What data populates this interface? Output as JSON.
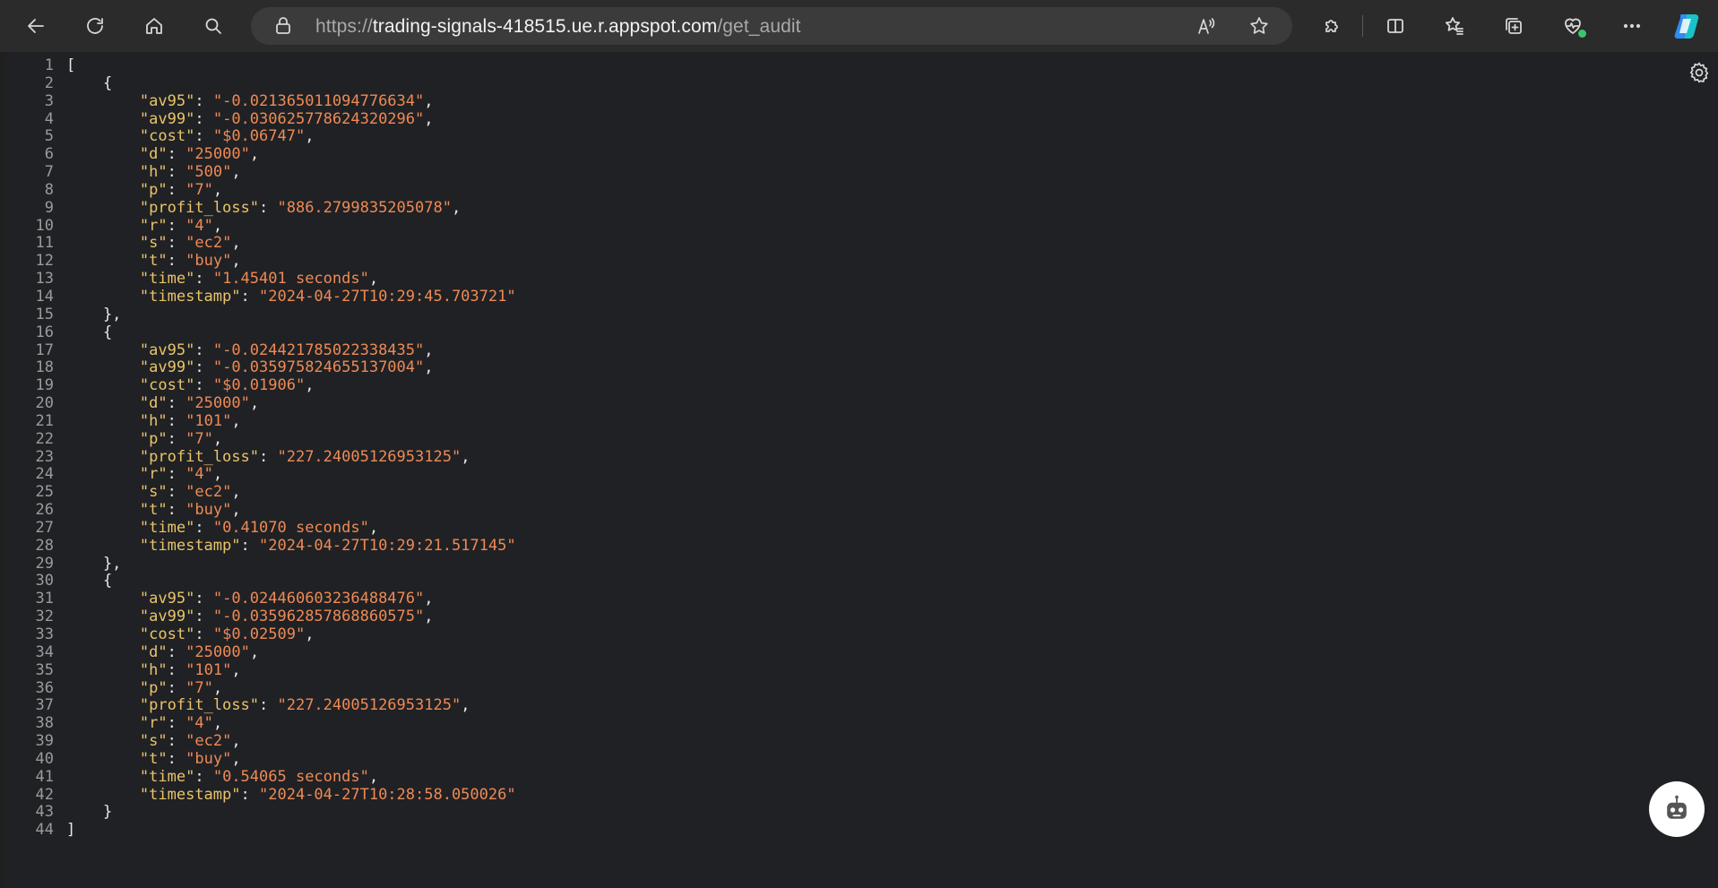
{
  "browser": {
    "url_scheme": "https://",
    "url_host": "trading-signals-418515.ue.r.appspot.com",
    "url_path": "/get_audit"
  },
  "json_view": {
    "lines": [
      {
        "n": "1",
        "t": "[",
        "kind": "punct"
      },
      {
        "n": "2",
        "t": "    {",
        "kind": "punct"
      },
      {
        "n": "3",
        "k": "av95",
        "v": "-0.021365011094776634",
        "indent": "        ",
        "tail": ","
      },
      {
        "n": "4",
        "k": "av99",
        "v": "-0.030625778624320296",
        "indent": "        ",
        "tail": ","
      },
      {
        "n": "5",
        "k": "cost",
        "v": "$0.06747",
        "indent": "        ",
        "tail": ","
      },
      {
        "n": "6",
        "k": "d",
        "v": "25000",
        "indent": "        ",
        "tail": ","
      },
      {
        "n": "7",
        "k": "h",
        "v": "500",
        "indent": "        ",
        "tail": ","
      },
      {
        "n": "8",
        "k": "p",
        "v": "7",
        "indent": "        ",
        "tail": ","
      },
      {
        "n": "9",
        "k": "profit_loss",
        "v": "886.2799835205078",
        "indent": "        ",
        "tail": ","
      },
      {
        "n": "10",
        "k": "r",
        "v": "4",
        "indent": "        ",
        "tail": ","
      },
      {
        "n": "11",
        "k": "s",
        "v": "ec2",
        "indent": "        ",
        "tail": ","
      },
      {
        "n": "12",
        "k": "t",
        "v": "buy",
        "indent": "        ",
        "tail": ","
      },
      {
        "n": "13",
        "k": "time",
        "v": "1.45401 seconds",
        "indent": "        ",
        "tail": ","
      },
      {
        "n": "14",
        "k": "timestamp",
        "v": "2024-04-27T10:29:45.703721",
        "indent": "        ",
        "tail": ""
      },
      {
        "n": "15",
        "t": "    },",
        "kind": "punct"
      },
      {
        "n": "16",
        "t": "    {",
        "kind": "punct"
      },
      {
        "n": "17",
        "k": "av95",
        "v": "-0.024421785022338435",
        "indent": "        ",
        "tail": ","
      },
      {
        "n": "18",
        "k": "av99",
        "v": "-0.035975824655137004",
        "indent": "        ",
        "tail": ","
      },
      {
        "n": "19",
        "k": "cost",
        "v": "$0.01906",
        "indent": "        ",
        "tail": ","
      },
      {
        "n": "20",
        "k": "d",
        "v": "25000",
        "indent": "        ",
        "tail": ","
      },
      {
        "n": "21",
        "k": "h",
        "v": "101",
        "indent": "        ",
        "tail": ","
      },
      {
        "n": "22",
        "k": "p",
        "v": "7",
        "indent": "        ",
        "tail": ","
      },
      {
        "n": "23",
        "k": "profit_loss",
        "v": "227.24005126953125",
        "indent": "        ",
        "tail": ","
      },
      {
        "n": "24",
        "k": "r",
        "v": "4",
        "indent": "        ",
        "tail": ","
      },
      {
        "n": "25",
        "k": "s",
        "v": "ec2",
        "indent": "        ",
        "tail": ","
      },
      {
        "n": "26",
        "k": "t",
        "v": "buy",
        "indent": "        ",
        "tail": ","
      },
      {
        "n": "27",
        "k": "time",
        "v": "0.41070 seconds",
        "indent": "        ",
        "tail": ","
      },
      {
        "n": "28",
        "k": "timestamp",
        "v": "2024-04-27T10:29:21.517145",
        "indent": "        ",
        "tail": ""
      },
      {
        "n": "29",
        "t": "    },",
        "kind": "punct"
      },
      {
        "n": "30",
        "t": "    {",
        "kind": "punct"
      },
      {
        "n": "31",
        "k": "av95",
        "v": "-0.024460603236488476",
        "indent": "        ",
        "tail": ","
      },
      {
        "n": "32",
        "k": "av99",
        "v": "-0.035962857868860575",
        "indent": "        ",
        "tail": ","
      },
      {
        "n": "33",
        "k": "cost",
        "v": "$0.02509",
        "indent": "        ",
        "tail": ","
      },
      {
        "n": "34",
        "k": "d",
        "v": "25000",
        "indent": "        ",
        "tail": ","
      },
      {
        "n": "35",
        "k": "h",
        "v": "101",
        "indent": "        ",
        "tail": ","
      },
      {
        "n": "36",
        "k": "p",
        "v": "7",
        "indent": "        ",
        "tail": ","
      },
      {
        "n": "37",
        "k": "profit_loss",
        "v": "227.24005126953125",
        "indent": "        ",
        "tail": ","
      },
      {
        "n": "38",
        "k": "r",
        "v": "4",
        "indent": "        ",
        "tail": ","
      },
      {
        "n": "39",
        "k": "s",
        "v": "ec2",
        "indent": "        ",
        "tail": ","
      },
      {
        "n": "40",
        "k": "t",
        "v": "buy",
        "indent": "        ",
        "tail": ","
      },
      {
        "n": "41",
        "k": "time",
        "v": "0.54065 seconds",
        "indent": "        ",
        "tail": ","
      },
      {
        "n": "42",
        "k": "timestamp",
        "v": "2024-04-27T10:28:58.050026",
        "indent": "        ",
        "tail": ""
      },
      {
        "n": "43",
        "t": "    }",
        "kind": "punct"
      },
      {
        "n": "44",
        "t": "]",
        "kind": "punct"
      }
    ]
  },
  "icons": {
    "back": "back-arrow-icon",
    "reload": "reload-icon",
    "home": "home-icon",
    "search": "search-icon",
    "lock": "lock-icon",
    "read_aloud": "read-aloud-icon",
    "favorite": "star-icon",
    "extensions": "puzzle-icon",
    "split": "split-screen-icon",
    "favorites": "favorites-icon",
    "collections": "collections-icon",
    "health": "browser-essentials-icon",
    "more": "more-icon",
    "copilot": "copilot-icon",
    "settings": "gear-icon",
    "assistant": "bot-icon"
  },
  "colors": {
    "key": "#e8c46a",
    "string": "#ee8a55",
    "background": "#202124"
  }
}
